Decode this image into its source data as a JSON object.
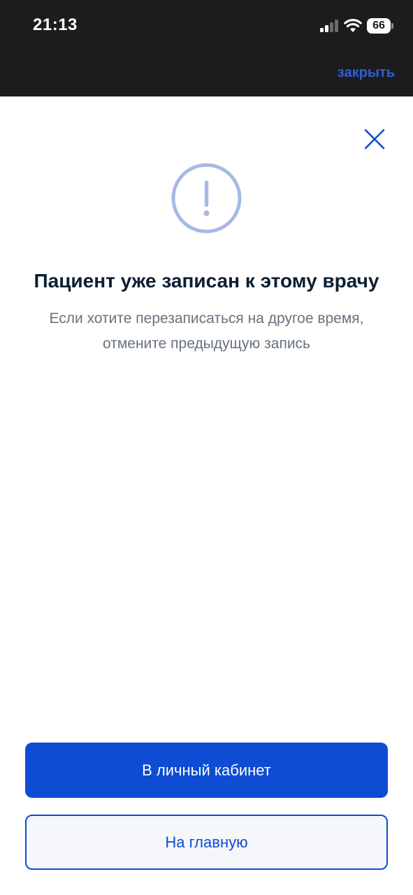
{
  "status_bar": {
    "time": "21:13",
    "battery": "66"
  },
  "header": {
    "close_link": "закрыть"
  },
  "dialog": {
    "title": "Пациент уже записан к этому врачу",
    "message_line1": "Если хотите перезаписаться на другое время,",
    "message_line2": "отмените предыдущую запись"
  },
  "actions": {
    "primary_label": "В личный кабинет",
    "secondary_label": "На главную"
  },
  "icons": {
    "close": "close-icon",
    "alert": "exclamation-circle-icon"
  },
  "colors": {
    "accent": "#0d4cd3",
    "alert_icon": "#a6b9e6",
    "title": "#0b1f33",
    "text_secondary": "#66727f",
    "status_bar_bg": "#1c1c1e"
  }
}
